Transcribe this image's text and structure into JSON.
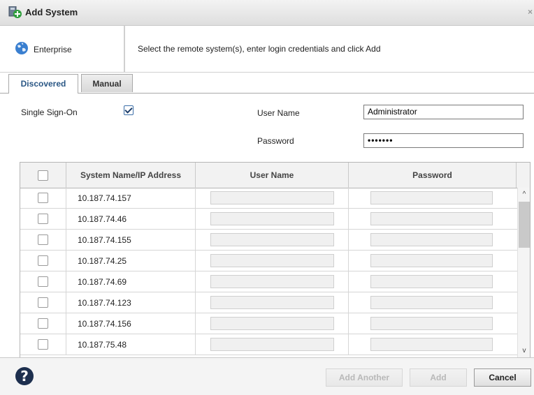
{
  "dialog": {
    "title": "Add System",
    "title_icon": "add-system-icon",
    "close_glyph": "×"
  },
  "header": {
    "context_label": "Enterprise",
    "context_icon": "globe-icon",
    "instructions": "Select the remote system(s), enter login credentials and click Add"
  },
  "tabs": [
    {
      "label": "Discovered",
      "active": true
    },
    {
      "label": "Manual",
      "active": false
    }
  ],
  "form": {
    "sso_label": "Single Sign-On",
    "sso_checked": true,
    "username_label": "User Name",
    "username_value": "Administrator",
    "password_label": "Password",
    "password_value": "•••••••"
  },
  "grid": {
    "columns": [
      "",
      "System Name/IP Address",
      "User Name",
      "Password"
    ],
    "rows": [
      {
        "address": "10.187.74.157"
      },
      {
        "address": "10.187.74.46"
      },
      {
        "address": "10.187.74.155"
      },
      {
        "address": "10.187.74.25"
      },
      {
        "address": "10.187.74.69"
      },
      {
        "address": "10.187.74.123"
      },
      {
        "address": "10.187.74.156"
      },
      {
        "address": "10.187.75.48"
      }
    ]
  },
  "scrollbar": {
    "up_glyph": "^",
    "down_glyph": "v"
  },
  "footer": {
    "help_glyph": "?",
    "add_another_label": "Add Another",
    "add_label": "Add",
    "cancel_label": "Cancel"
  },
  "colors": {
    "accent": "#2a5785",
    "help_bg": "#1d2f4e"
  }
}
